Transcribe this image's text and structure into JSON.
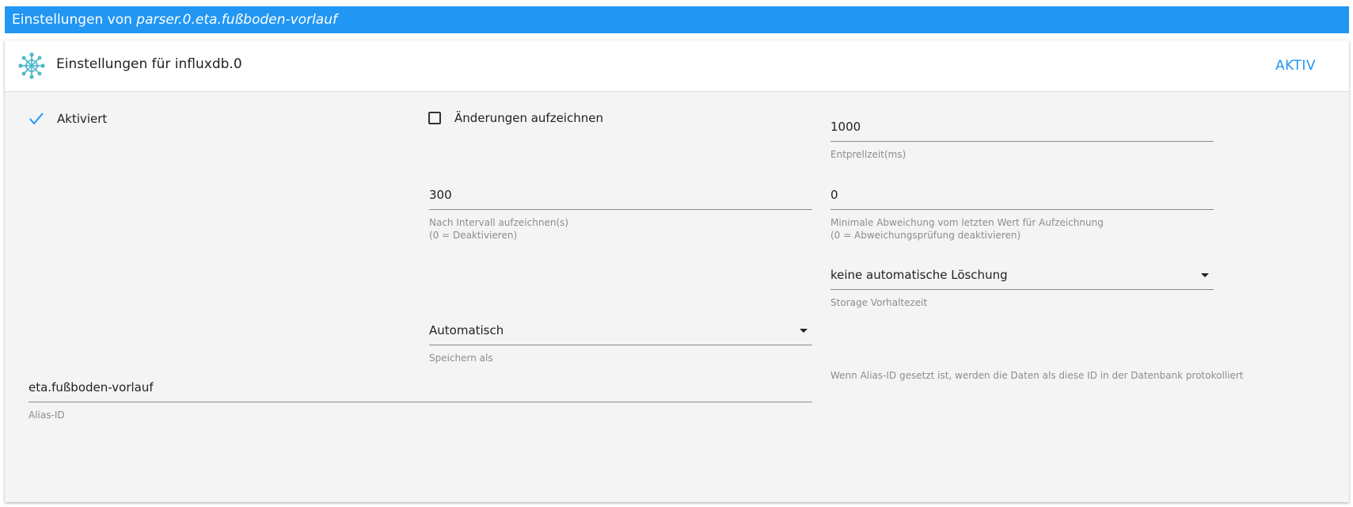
{
  "titlebar": {
    "prefix": "Einstellungen von ",
    "object_id": "parser.0.eta.fußboden-vorlauf"
  },
  "header": {
    "title": "Einstellungen für influxdb.0",
    "state_button": "AKTIV",
    "icon": "influxdb-logo-icon"
  },
  "form": {
    "enabled_label": "Aktiviert",
    "enabled_checked": true,
    "changes_only_label": "Änderungen aufzeichnen",
    "changes_only_checked": false,
    "debounce": {
      "value": "1000",
      "helper": "Entprellzeit(ms)"
    },
    "interval": {
      "value": "300",
      "helper_line1": "Nach Intervall aufzeichnen(s)",
      "helper_line2": "(0 = Deaktivieren)"
    },
    "min_diff": {
      "value": "0",
      "helper_line1": "Minimale Abweichung vom letzten Wert für Aufzeichnung",
      "helper_line2": "(0 = Abweichungsprüfung deaktivieren)"
    },
    "retention": {
      "value": "keine automatische Löschung",
      "helper": "Storage Vorhaltezeit"
    },
    "store_as": {
      "value": "Automatisch",
      "helper": "Speichern als"
    },
    "alias_note": "Wenn Alias-ID gesetzt ist, werden die Daten als diese ID in der Datenbank protokolliert",
    "alias": {
      "value": "eta.fußboden-vorlauf",
      "helper": "Alias-ID"
    }
  },
  "colors": {
    "primary": "#2196f3",
    "card_bg": "#f4f4f4",
    "icon_teal": "#4fb8c9"
  }
}
